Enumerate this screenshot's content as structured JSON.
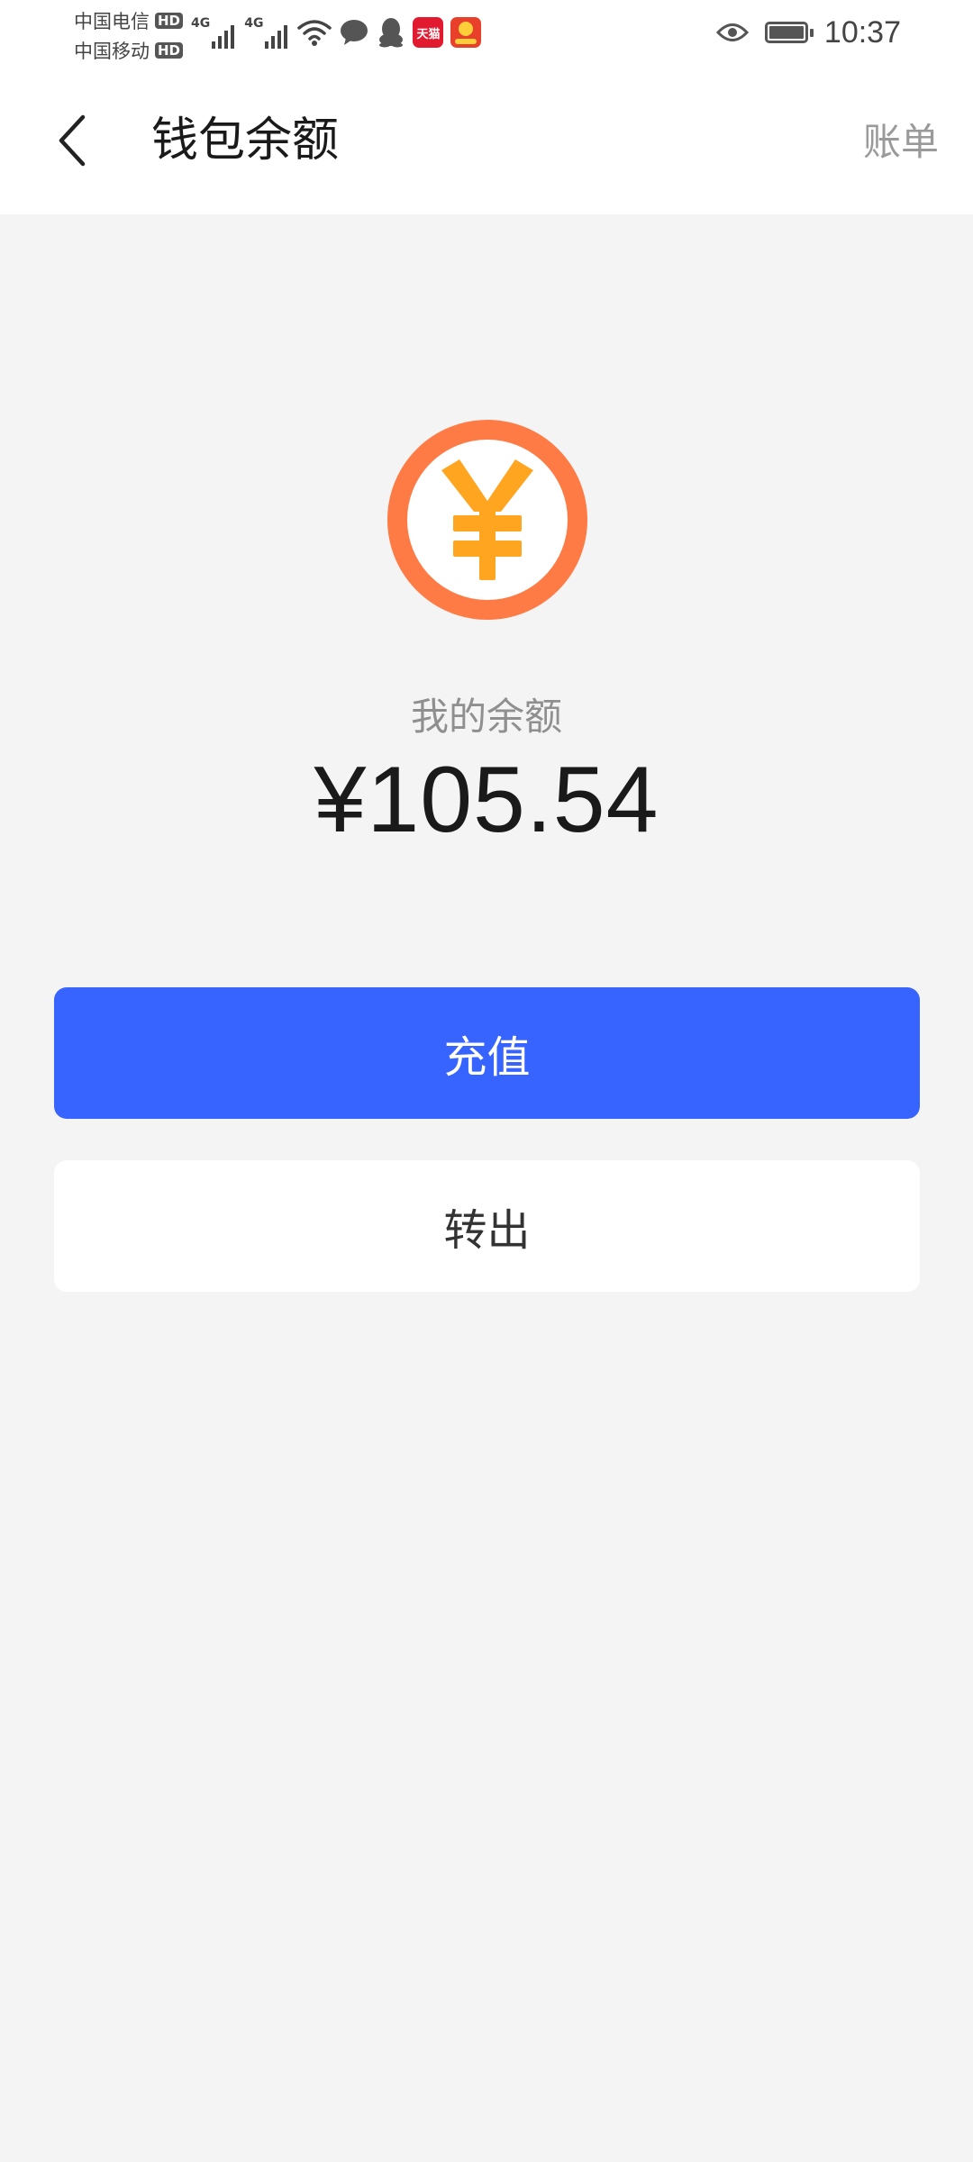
{
  "status_bar": {
    "carrier_1": "中国电信",
    "carrier_2": "中国移动",
    "hd_label": "HD",
    "network_type": "4G",
    "app_icon_tmall": "天猫",
    "time": "10:37",
    "icons": [
      "signal-icon",
      "wifi-icon",
      "message-icon",
      "qq-icon",
      "tmall-icon",
      "lottery-app-icon",
      "eye-icon",
      "battery-icon"
    ],
    "battery_level": 0.9
  },
  "header": {
    "title": "钱包余额",
    "bill_link": "账单",
    "back_icon": "chevron-left-icon"
  },
  "balance": {
    "label": "我的余额",
    "amount": "¥105.54",
    "coin_icon": "yuan-coin-icon",
    "coin_symbol": "¥"
  },
  "actions": {
    "recharge_label": "充值",
    "transfer_out_label": "转出"
  },
  "colors": {
    "primary_button": "#3763fe",
    "coin_ring": "#ff7b45",
    "coin_symbol": "#ffa51f",
    "page_background": "#f4f4f4"
  }
}
